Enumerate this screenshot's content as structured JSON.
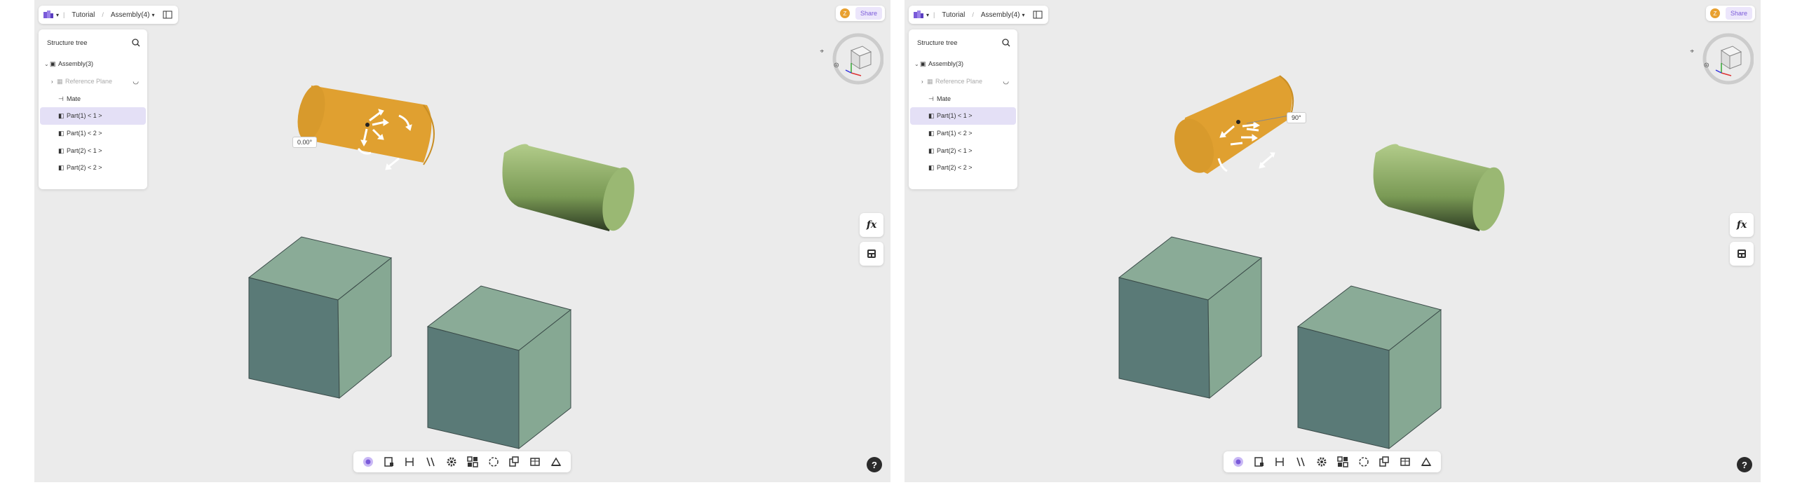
{
  "panes": [
    {
      "id": "left",
      "topbar": {
        "tutorial": "Tutorial",
        "assembly": "Assembly(4)"
      },
      "avatar_initial": "Z",
      "share_label": "Share",
      "tree": {
        "title": "Structure tree",
        "items": [
          {
            "label": "Assembly(3)"
          },
          {
            "label": "Reference Plane"
          },
          {
            "label": "Mate"
          },
          {
            "label": "Part(1) < 1 >",
            "selected": true
          },
          {
            "label": "Part(1) < 2 >"
          },
          {
            "label": "Part(2) < 1 >"
          },
          {
            "label": "Part(2) < 2 >"
          }
        ]
      },
      "angle_label": "0.00°",
      "fx_label": "fx",
      "help_label": "?"
    },
    {
      "id": "right",
      "topbar": {
        "tutorial": "Tutorial",
        "assembly": "Assembly(4)"
      },
      "avatar_initial": "Z",
      "share_label": "Share",
      "tree": {
        "title": "Structure tree",
        "items": [
          {
            "label": "Assembly(3)"
          },
          {
            "label": "Reference Plane"
          },
          {
            "label": "Mate"
          },
          {
            "label": "Part(1) < 1 >",
            "selected": true
          },
          {
            "label": "Part(1) < 2 >"
          },
          {
            "label": "Part(2) < 1 >"
          },
          {
            "label": "Part(2) < 2 >"
          }
        ]
      },
      "angle_label": "90°",
      "fx_label": "fx",
      "help_label": "?"
    }
  ],
  "colors": {
    "viewport_bg": "#ebebeb",
    "orange_cylinder": "#e0a030",
    "green_cylinder": "#8fae68",
    "cube_top": "#8aab97",
    "cube_front": "#5a7a77",
    "cube_side": "#86a893",
    "accent": "#7a5ad9",
    "selected_row": "#e4e0f6"
  },
  "icons": [
    "app-logo-icon",
    "chevron-down-icon",
    "split-view-icon",
    "search-icon",
    "eye-icon",
    "mate-icon",
    "part-icon",
    "reference-plane-icon",
    "view-cube-icon",
    "fx-icon",
    "calculator-icon",
    "help-icon"
  ]
}
